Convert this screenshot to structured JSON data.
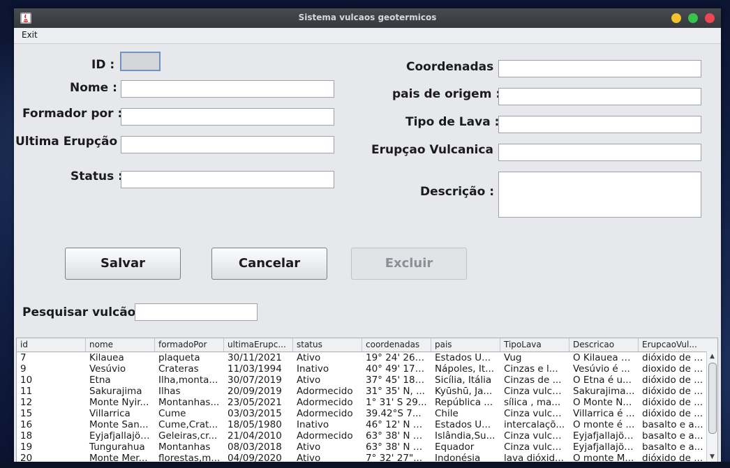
{
  "window": {
    "title": "Sistema vulcaos geotermicos"
  },
  "menu": {
    "exit": "Exit"
  },
  "form": {
    "id_label": "ID :",
    "nome_label": "Nome :",
    "formador_label": "Formador por :",
    "ultima_label": "Ultima Erupção :",
    "status_label": "Status :",
    "coordenadas_label": "Coordenadas :",
    "pais_label": "pais de origem :",
    "tipo_label": "Tipo de Lava :",
    "erupcao_label": "Erupçao Vulcanica :",
    "descricao_label": "Descrição :",
    "id_value": "",
    "nome_value": "",
    "formador_value": "",
    "ultima_value": "",
    "status_value": "",
    "coordenadas_value": "",
    "pais_value": "",
    "tipo_value": "",
    "erupcao_value": "",
    "descricao_value": ""
  },
  "buttons": {
    "salvar": "Salvar",
    "cancelar": "Cancelar",
    "excluir": "Excluir"
  },
  "search": {
    "label": "Pesquisar vulcão :",
    "value": ""
  },
  "table": {
    "columns": [
      "id",
      "nome",
      "formadoPor",
      "ultimaErupc...",
      "status",
      "coordenadas",
      "pais",
      "TipoLava",
      "Descricao",
      "ErupcaoVul..."
    ],
    "rows": [
      [
        "7",
        "Kilauea",
        "plaqueta",
        "30/11/2021",
        "Ativo",
        "19° 24' 26\"...",
        "Estados U...",
        "Vug",
        "O Kilauea é...",
        "dióxido de ..."
      ],
      [
        "9",
        "Vesúvio",
        "Crateras",
        "11/03/1994",
        "Inativo",
        "40° 49' 17\"...",
        "Nápoles, It...",
        "Cinzas e l...",
        "Vesúvio é ...",
        "dioxido de ..."
      ],
      [
        "10",
        "Etna",
        "Ilha,monta...",
        "30/07/2019",
        "Ativo",
        "37° 45' 18\"...",
        "Sicília, Itália",
        "Cinzas de ...",
        "O Etna é u...",
        "dióxido de ..."
      ],
      [
        "11",
        "Sakurajima",
        "Ilhas",
        "20/09/2019",
        "Adormecido",
        "31° 35' N, ...",
        "Kyūshū, Ja...",
        "Cinza vulcâ...",
        "Sakurajima...",
        "dióxido de ..."
      ],
      [
        "12",
        "Monte Nyir...",
        "Montanhas...",
        "23/05/2021",
        "Adormecido",
        "1° 31' S 29...",
        "República ...",
        "sílica , ma...",
        "O Monte N...",
        "dióxido de ..."
      ],
      [
        "15",
        "Villarrica",
        "Cume",
        "03/03/2015",
        "Adormecido",
        "39.42°S 7...",
        "Chile",
        "Cinza vulcâ...",
        "Villarrica é ...",
        "dióxido de ..."
      ],
      [
        "16",
        "Monte San...",
        "Cume,Crat...",
        "18/05/1980",
        "Inativo",
        "46° 12' N 1...",
        "Estados U...",
        "intercalaçõ...",
        "O monte é ...",
        "basalto e a..."
      ],
      [
        "18",
        "Eyjafjallajök...",
        "Geleiras,cr...",
        "21/04/2010",
        "Adormecido",
        "63° 38' N 1...",
        "Islândia,Su...",
        "Cinza vulcâ...",
        "Eyjafjallajök...",
        "basalto e a..."
      ],
      [
        "19",
        "Tungurahua",
        "Montanhas",
        "08/03/2018",
        "Ativo",
        "63° 38' N 1...",
        "Equador",
        "Cinza vulcâ...",
        "Eyjafjallajök...",
        "basalto e a..."
      ],
      [
        "20",
        "Monte Mer...",
        "florestas,m...",
        "04/09/2020",
        "Ativo",
        "7° 32' 27\"...",
        "Indonésia",
        "lava dióxid...",
        "O monte M...",
        "dióxido de ..."
      ]
    ]
  }
}
